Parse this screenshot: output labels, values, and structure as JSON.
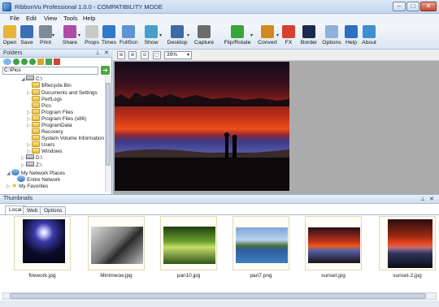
{
  "window": {
    "title": "RibbonVu Professional  1.0.0 - COMPATIBILITY MODE",
    "minimize": "–",
    "maximize": "□",
    "close": "✕"
  },
  "menu": {
    "items": [
      "File",
      "Edit",
      "View",
      "Tools",
      "Help"
    ]
  },
  "toolbar": {
    "buttons": [
      {
        "label": "Open",
        "icon": "open-folder-icon",
        "color": "#e7b43a"
      },
      {
        "label": "Save",
        "icon": "save-disk-icon",
        "color": "#3d6fb5"
      },
      {
        "label": "Print",
        "icon": "printer-icon",
        "color": "#7d8a98"
      },
      {
        "label": "Share",
        "icon": "share-people-icon",
        "color": "#b04ba8"
      },
      {
        "label": "Props",
        "icon": "properties-icon",
        "color": "#c9c9c9"
      },
      {
        "label": "Times",
        "icon": "globe-clock-icon",
        "color": "#2f79c8"
      },
      {
        "label": "FullScn",
        "icon": "fullscreen-icon",
        "color": "#5d94d6"
      },
      {
        "label": "Show",
        "icon": "slideshow-icon",
        "color": "#48a0c8"
      },
      {
        "label": "Desktop",
        "icon": "desktop-icon",
        "color": "#3f6aa8"
      },
      {
        "label": "Capture",
        "icon": "camera-icon",
        "color": "#6c6c6c"
      },
      {
        "label": "Flip/Rotate",
        "icon": "rotate-icon",
        "color": "#3aa53a"
      },
      {
        "label": "Convert",
        "icon": "convert-icon",
        "color": "#d08a20"
      },
      {
        "label": "FX",
        "icon": "fx-icon",
        "color": "#d6402f"
      },
      {
        "label": "Border",
        "icon": "border-icon",
        "color": "#1b2b4d"
      },
      {
        "label": "Options",
        "icon": "options-gear-icon",
        "color": "#8fb0d8"
      },
      {
        "label": "Help",
        "icon": "help-icon",
        "color": "#2d6fc1"
      },
      {
        "label": "About",
        "icon": "about-icon",
        "color": "#3e8ed0"
      }
    ]
  },
  "folders": {
    "title": "Folders",
    "path": "C:\\Pics",
    "tree": [
      {
        "label": "C:\\",
        "type": "drive"
      },
      {
        "label": "$Recycle.Bin",
        "type": "folder"
      },
      {
        "label": "Documents and Settings",
        "type": "folder"
      },
      {
        "label": "PerfLogs",
        "type": "folder"
      },
      {
        "label": "Pics",
        "type": "folder"
      },
      {
        "label": "Program Files",
        "type": "folder"
      },
      {
        "label": "Program Files (x86)",
        "type": "folder"
      },
      {
        "label": "ProgramData",
        "type": "folder"
      },
      {
        "label": "Recovery",
        "type": "folder"
      },
      {
        "label": "System Volume Information",
        "type": "folder"
      },
      {
        "label": "Users",
        "type": "folder"
      },
      {
        "label": "Windows",
        "type": "folder"
      },
      {
        "label": "D:\\",
        "type": "drive"
      },
      {
        "label": "Z:\\",
        "type": "drive"
      },
      {
        "label": "My Network Places",
        "type": "network"
      },
      {
        "label": "Entire Network",
        "type": "network"
      },
      {
        "label": "My Favorites",
        "type": "star"
      }
    ]
  },
  "viewer": {
    "zoom": "39%"
  },
  "thumbnails": {
    "title": "Thumbnails",
    "tabs": [
      "Local",
      "Web",
      "Options"
    ],
    "items": [
      {
        "label": "firework.jpg"
      },
      {
        "label": "Minimeow.jpg"
      },
      {
        "label": "pan10.jpg"
      },
      {
        "label": "pan7.png"
      },
      {
        "label": "sunset.jpg"
      },
      {
        "label": "sunset-2.jpg"
      }
    ]
  }
}
